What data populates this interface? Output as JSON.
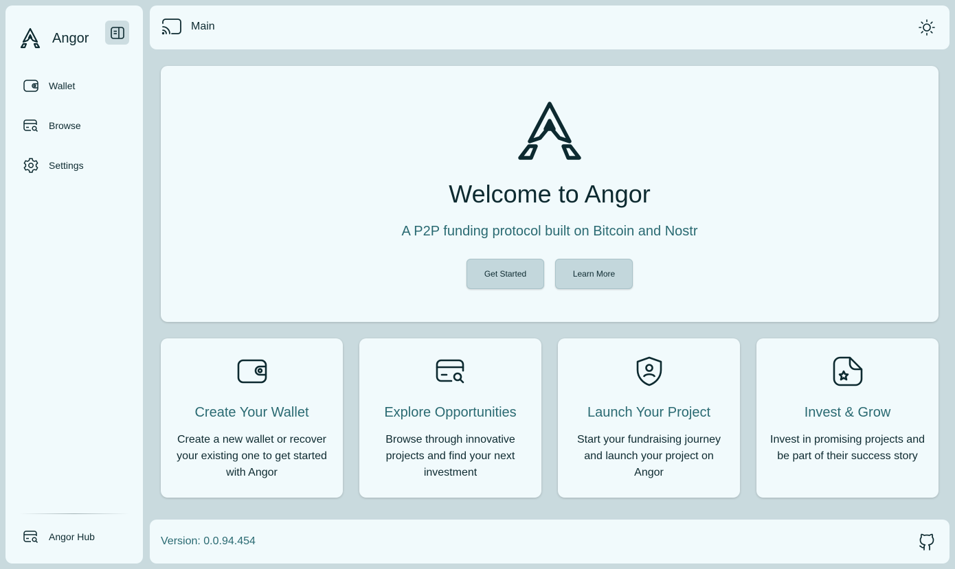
{
  "sidebar": {
    "brand": "Angor",
    "items": [
      {
        "label": "Wallet",
        "icon": "wallet-icon"
      },
      {
        "label": "Browse",
        "icon": "browse-icon"
      },
      {
        "label": "Settings",
        "icon": "gear-icon"
      }
    ],
    "footer_item": {
      "label": "Angor Hub",
      "icon": "browse-icon"
    }
  },
  "topbar": {
    "title": "Main",
    "left_icon": "cast-icon",
    "right_icon": "sun-icon"
  },
  "hero": {
    "title": "Welcome to Angor",
    "subtitle": "A P2P funding protocol built on Bitcoin and Nostr",
    "primary_button": "Get Started",
    "secondary_button": "Learn More"
  },
  "cards": [
    {
      "title": "Create Your Wallet",
      "description": "Create a new wallet or recover your existing one to get started with Angor",
      "icon": "wallet-icon"
    },
    {
      "title": "Explore Opportunities",
      "description": "Browse through innovative projects and find your next investment",
      "icon": "browse-icon"
    },
    {
      "title": "Launch Your Project",
      "description": "Start your fundraising journey and launch your project on Angor",
      "icon": "shield-user-icon"
    },
    {
      "title": "Invest & Grow",
      "description": "Invest in promising projects and be part of their success story",
      "icon": "document-star-icon"
    }
  ],
  "footer": {
    "version": "Version: 0.0.94.454",
    "right_icon": "github-icon"
  },
  "colors": {
    "background": "#c9dade",
    "panel": "#f1fafc",
    "text": "#0d2a30",
    "accent": "#2a6a72",
    "button": "#c3d7dc"
  }
}
